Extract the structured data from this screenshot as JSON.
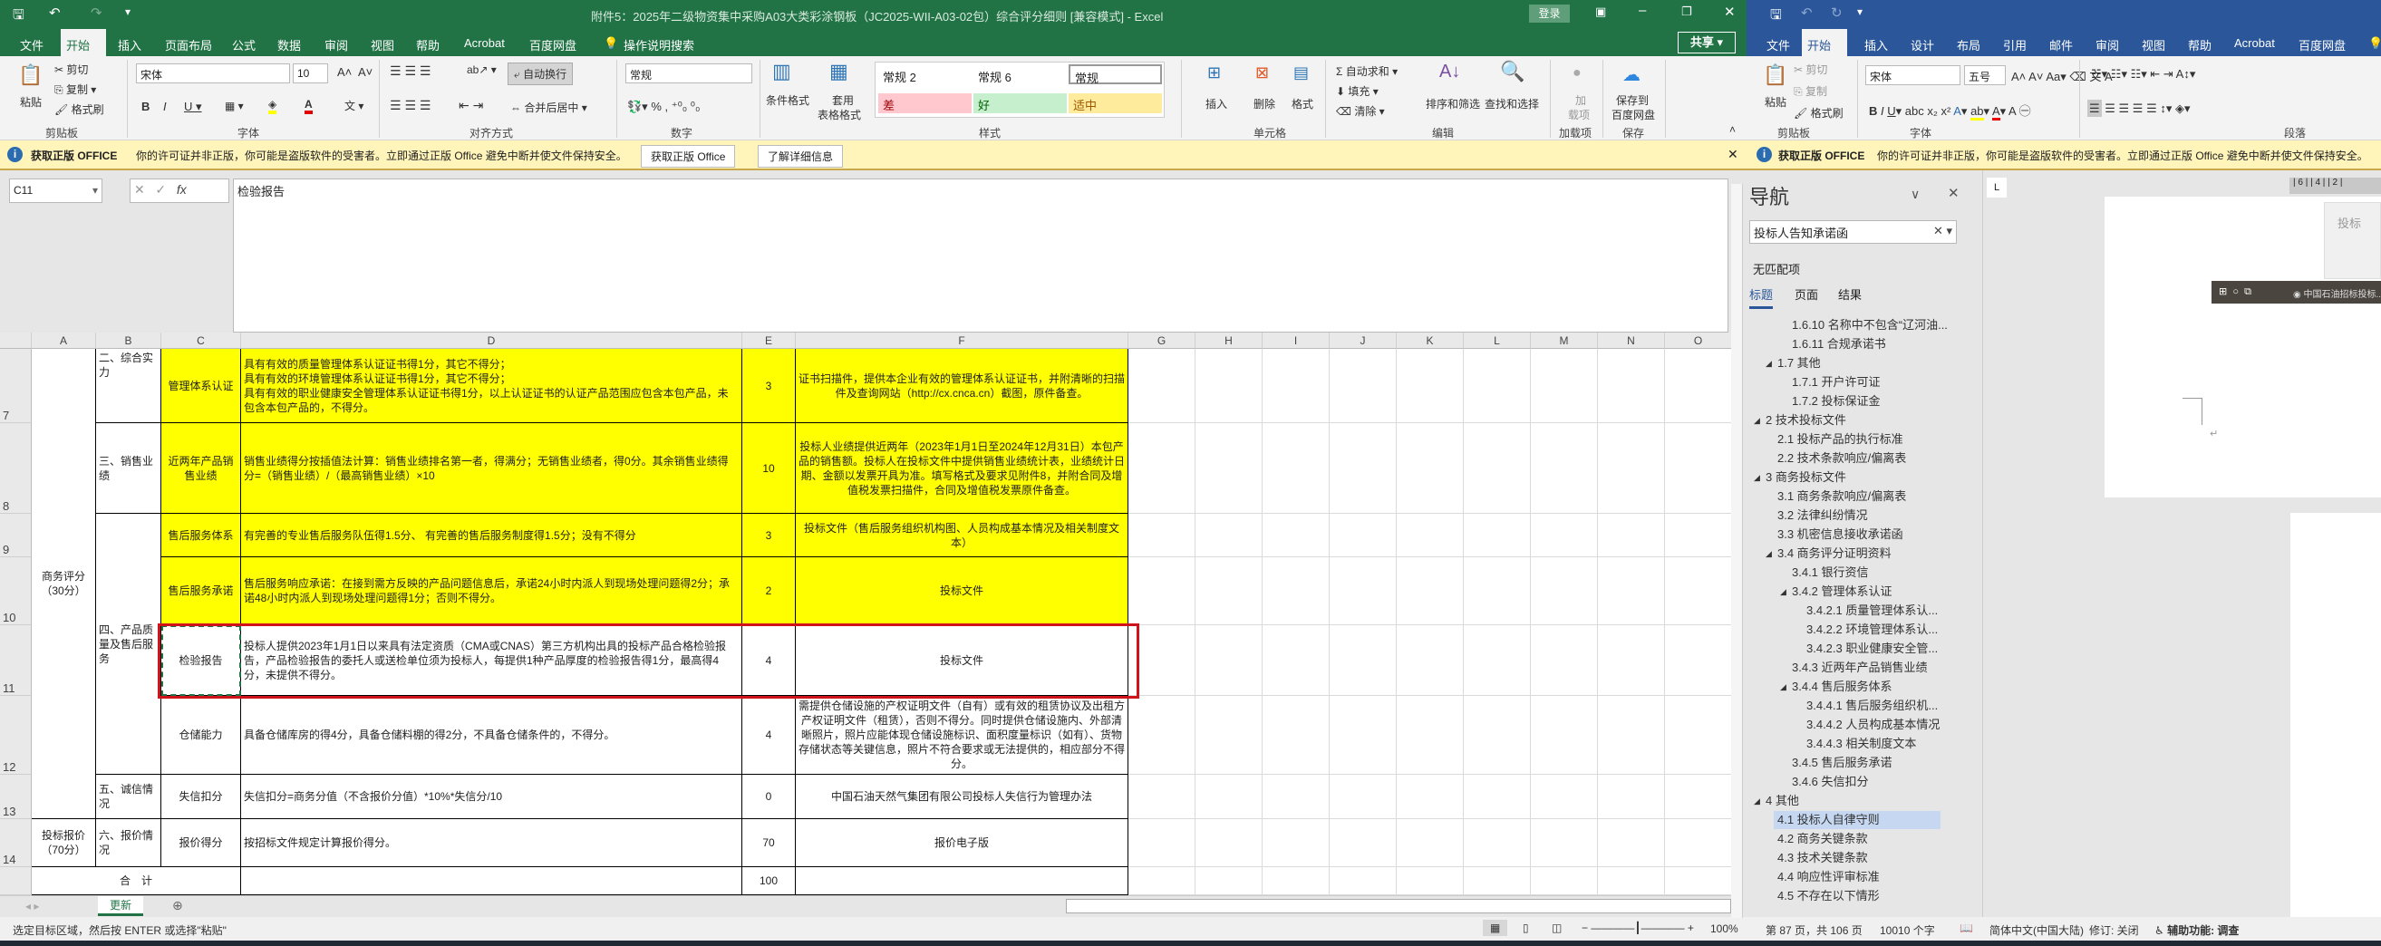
{
  "excel": {
    "title": "附件5：2025年二级物资集中采购A03大类彩涂钢板（JC2025-WII-A03-02包）综合评分细则 [兼容模式] - Excel",
    "login": "登录",
    "share": "共享",
    "tabs": [
      "文件",
      "开始",
      "插入",
      "页面布局",
      "公式",
      "数据",
      "审阅",
      "视图",
      "帮助",
      "Acrobat",
      "百度网盘",
      "操作说明搜索"
    ],
    "ribbon": {
      "paste": "粘贴",
      "cut": "剪切",
      "copy": "复制",
      "format_painter": "格式刷",
      "clipboard": "剪贴板",
      "font_name": "宋体",
      "font_size": "10",
      "font": "字体",
      "wrap_text": "自动换行",
      "merge_center": "合并后居中",
      "alignment": "对齐方式",
      "number_format": "常规",
      "number": "数字",
      "conditional_format": "条件格式",
      "table_format_1": "套用",
      "table_format_2": "表格格式",
      "styles": [
        {
          "label": "常规 2"
        },
        {
          "label": "常规 6"
        },
        {
          "label": "常规"
        },
        {
          "label": "差",
          "bg": "#ffc7ce",
          "fg": "#9c0006"
        },
        {
          "label": "好",
          "bg": "#c6efce",
          "fg": "#006100"
        },
        {
          "label": "适中",
          "bg": "#ffeb9c",
          "fg": "#9c5700"
        }
      ],
      "styles_group": "样式",
      "insert": "插入",
      "delete": "删除",
      "format": "格式",
      "cells": "单元格",
      "autosum": "自动求和",
      "fill": "填充",
      "clear": "清除",
      "sort_filter": "排序和筛选",
      "find_select": "查找和选择",
      "editing": "编辑",
      "addins_1": "加",
      "addins_2": "载项",
      "addins": "加载项",
      "save_baidu_1": "保存到",
      "save_baidu_2": "百度网盘",
      "save": "保存"
    },
    "info_bar": {
      "title": "获取正版 OFFICE",
      "message": "你的许可证并非正版，你可能是盗版软件的受害者。立即通过正版 Office 避免中断并使文件保持安全。",
      "btn_get": "获取正版 Office",
      "btn_more": "了解详细信息"
    },
    "name_box": "C11",
    "formula": "检验报告",
    "columns": [
      "A",
      "B",
      "C",
      "D",
      "E",
      "F",
      "G",
      "H",
      "I",
      "J",
      "K",
      "L",
      "M",
      "N",
      "O"
    ],
    "rows": [
      "7",
      "8",
      "9",
      "10",
      "11",
      "12",
      "13",
      "14"
    ],
    "cells": {
      "A7": "商务评分\n（30分）",
      "B7": "二、综合实力",
      "C7": "管理体系认证",
      "D7": "具有有效的质量管理体系认证证书得1分，其它不得分；\n具有有效的环境管理体系认证证书得1分，其它不得分；\n具有有效的职业健康安全管理体系认证证书得1分，以上认证证书的认证产品范围应包含本包产品，未包含本包产品的，不得分。",
      "E7": "3",
      "F7": "证书扫描件，提供本企业有效的管理体系认证证书，并附清晰的扫描件及查询网站（http://cx.cnca.cn）截图，原件备查。",
      "B8": "三、销售业绩",
      "C8": "近两年产品销售业绩",
      "D8": "销售业绩得分按插值法计算：销售业绩排名第一者，得满分；无销售业绩者，得0分。其余销售业绩得分=（销售业绩）/（最高销售业绩）×10",
      "E8": "10",
      "F8": "投标人业绩提供近两年（2023年1月1日至2024年12月31日）本包产品的销售额。投标人在投标文件中提供销售业绩统计表，业绩统计日期、金额以发票开具为准。填写格式及要求见附件8，并附合同及增值税发票扫描件，合同及增值税发票原件备查。",
      "B9": "四、产品质量及售后服务",
      "C9": "售后服务体系",
      "D9": "有完善的专业售后服务队伍得1.5分、 有完善的售后服务制度得1.5分；没有不得分",
      "E9": "3",
      "F9": "投标文件（售后服务组织机构图、人员构成基本情况及相关制度文本）",
      "C10": "售后服务承诺",
      "D10": "售后服务响应承诺：在接到需方反映的产品问题信息后，承诺24小时内派人到现场处理问题得2分；承诺48小时内派人到现场处理问题得1分；否则不得分。",
      "E10": "2",
      "F10": "投标文件",
      "C11": "检验报告",
      "D11": "投标人提供2023年1月1日以来具有法定资质（CMA或CNAS）第三方机构出具的投标产品合格检验报告，产品检验报告的委托人或送检单位须为投标人，每提供1种产品厚度的检验报告得1分，最高得4分，未提供不得分。",
      "E11": "4",
      "F11": "投标文件",
      "C12": "仓储能力",
      "D12": "具备仓储库房的得4分，具备仓储料棚的得2分，不具备仓储条件的，不得分。",
      "E12": "4",
      "F12": "需提供仓储设施的产权证明文件（自有）或有效的租赁协议及出租方产权证明文件（租赁），否则不得分。同时提供仓储设施内、外部清晰照片，照片应能体现仓储设施标识、面积度量标识（如有）、货物存储状态等关键信息，照片不符合要求或无法提供的，相应部分不得分。",
      "B13": "五、诚信情况",
      "C13": "失信扣分",
      "D13": "失信扣分=商务分值（不含报价分值）*10%*失信分/10",
      "E13": "0",
      "F13": "中国石油天然气集团有限公司投标人失信行为管理办法",
      "A14": "投标报价\n（70分）",
      "B14": "六、报价情况",
      "C14": "报价得分",
      "D14": "按招标文件规定计算报价得分。",
      "E14": "70",
      "F14": "报价电子版",
      "A15": "合　计",
      "D15": "",
      "E15": "100",
      "F15": ""
    },
    "sheet_tab": "更新",
    "status_text": "选定目标区域，然后按 ENTER 或选择\"粘贴\"",
    "zoom": "100%",
    "highlight_color": "#d0121b"
  },
  "word": {
    "tabs": [
      "文件",
      "开始",
      "插入",
      "设计",
      "布局",
      "引用",
      "邮件",
      "审阅",
      "视图",
      "帮助",
      "Acrobat",
      "百度网盘"
    ],
    "ribbon": {
      "paste": "粘贴",
      "cut": "剪切",
      "copy": "复制",
      "format_painter": "格式刷",
      "clipboard": "剪贴板",
      "font_name": "宋体",
      "font_size": "五号",
      "font": "字体",
      "paragraph": "段落"
    },
    "info_bar": {
      "title": "获取正版 OFFICE",
      "message": "你的许可证并非正版，你可能是盗版软件的受害者。立即通过正版 Office 避免中断并使文件保持安全。"
    },
    "nav": {
      "title": "导航",
      "search_value": "投标人告知承诺函",
      "no_match": "无匹配项",
      "tabs": [
        "标题",
        "页面",
        "结果"
      ],
      "items": [
        {
          "label": "1.6.10 名称中不包含“辽河油...",
          "level": 3
        },
        {
          "label": "1.6.11 合规承诺书",
          "level": 3
        },
        {
          "label": "1.7 其他",
          "level": 2,
          "expanded": true
        },
        {
          "label": "1.7.1 开户许可证",
          "level": 3
        },
        {
          "label": "1.7.2 投标保证金",
          "level": 3
        },
        {
          "label": "2 技术投标文件",
          "level": 1,
          "expanded": true
        },
        {
          "label": "2.1 投标产品的执行标准",
          "level": 2
        },
        {
          "label": "2.2 技术条款响应/偏离表",
          "level": 2
        },
        {
          "label": "3 商务投标文件",
          "level": 1,
          "expanded": true
        },
        {
          "label": "3.1 商务条款响应/偏离表",
          "level": 2
        },
        {
          "label": "3.2 法律纠纷情况",
          "level": 2
        },
        {
          "label": "3.3 机密信息接收承诺函",
          "level": 2
        },
        {
          "label": "3.4 商务评分证明资料",
          "level": 2,
          "expanded": true
        },
        {
          "label": "3.4.1 银行资信",
          "level": 3
        },
        {
          "label": "3.4.2 管理体系认证",
          "level": 3,
          "expanded": true
        },
        {
          "label": "3.4.2.1 质量管理体系认...",
          "level": 4
        },
        {
          "label": "3.4.2.2 环境管理体系认...",
          "level": 4
        },
        {
          "label": "3.4.2.3 职业健康安全管...",
          "level": 4
        },
        {
          "label": "3.4.3 近两年产品销售业绩",
          "level": 3
        },
        {
          "label": "3.4.4 售后服务体系",
          "level": 3,
          "expanded": true
        },
        {
          "label": "3.4.4.1 售后服务组织机...",
          "level": 4
        },
        {
          "label": "3.4.4.2 人员构成基本情况",
          "level": 4
        },
        {
          "label": "3.4.4.3 相关制度文本",
          "level": 4
        },
        {
          "label": "3.4.5 售后服务承诺",
          "level": 3
        },
        {
          "label": "3.4.6 失信扣分",
          "level": 3
        },
        {
          "label": "4 其他",
          "level": 1,
          "expanded": true
        },
        {
          "label": "4.1 投标人自律守则",
          "level": 2,
          "selected": true
        },
        {
          "label": "4.2 商务关键条款",
          "level": 2
        },
        {
          "label": "4.3 技术关键条款",
          "level": 2
        },
        {
          "label": "4.4 响应性评审标准",
          "level": 2
        },
        {
          "label": "4.5 不存在以下情形",
          "level": 2
        }
      ]
    },
    "ruler": "| 6 |   | 4 |   | 2 |",
    "doc_box_text": "投标",
    "taskbar_thumb_text": "中国石油招标投标...",
    "status": {
      "page": "第 87 页，共 106 页",
      "words": "10010 个字",
      "language": "简体中文(中国大陆)",
      "track": "修订: 关闭",
      "accessibility": "辅助功能: 调查"
    }
  }
}
